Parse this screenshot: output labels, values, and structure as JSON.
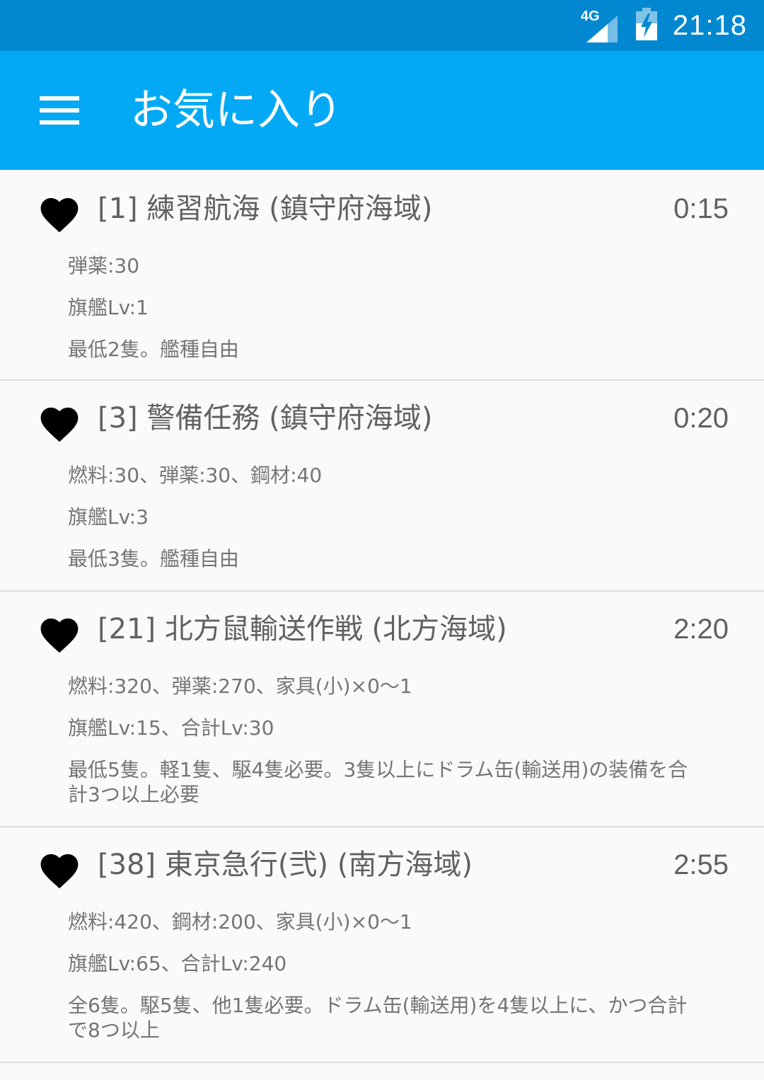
{
  "status_bar": {
    "network": "4G",
    "time": "21:18",
    "icons": [
      "signal-4g-icon",
      "battery-charging-icon"
    ]
  },
  "app_bar": {
    "menu_icon": "hamburger-menu-icon",
    "title": "お気に入り"
  },
  "expeditions": [
    {
      "title": "[1] 練習航海 (鎮守府海域)",
      "time": "0:15",
      "resources": "弾薬:30",
      "level": "旗艦Lv:1",
      "requirement": "最低2隻。艦種自由",
      "icon": "heart-icon"
    },
    {
      "title": "[3] 警備任務 (鎮守府海域)",
      "time": "0:20",
      "resources": "燃料:30、弾薬:30、鋼材:40",
      "level": "旗艦Lv:3",
      "requirement": "最低3隻。艦種自由",
      "icon": "heart-icon"
    },
    {
      "title": "[21] 北方鼠輸送作戦 (北方海域)",
      "time": "2:20",
      "resources": "燃料:320、弾薬:270、家具(小)×0〜1",
      "level": "旗艦Lv:15、合計Lv:30",
      "requirement": "最低5隻。軽1隻、駆4隻必要。3隻以上にドラム缶(輸送用)の装備を合計3つ以上必要",
      "icon": "heart-icon"
    },
    {
      "title": "[38] 東京急行(弐) (南方海域)",
      "time": "2:55",
      "resources": "燃料:420、鋼材:200、家具(小)×0〜1",
      "level": "旗艦Lv:65、合計Lv:240",
      "requirement": "全6隻。駆5隻、他1隻必要。ドラム缶(輸送用)を4隻以上に、かつ合計で8つ以上",
      "icon": "heart-icon"
    }
  ]
}
